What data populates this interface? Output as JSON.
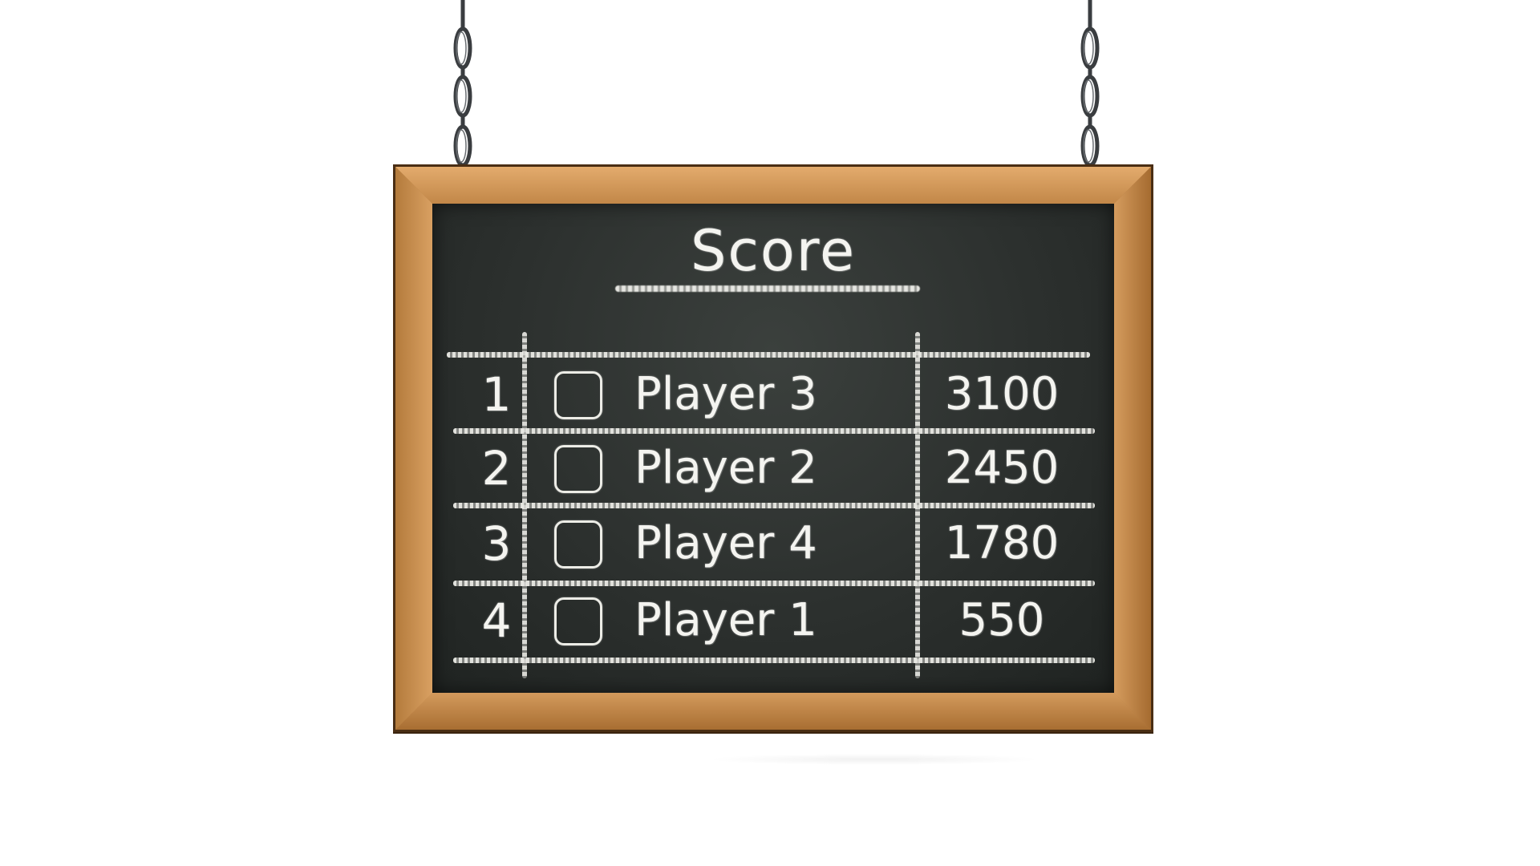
{
  "scoreboard": {
    "title": "Score",
    "rows": [
      {
        "rank": "1",
        "player": "Player 3",
        "score": "3100"
      },
      {
        "rank": "2",
        "player": "Player 2",
        "score": "2450"
      },
      {
        "rank": "3",
        "player": "Player 4",
        "score": "1780"
      },
      {
        "rank": "4",
        "player": "Player 1",
        "score": "550"
      }
    ]
  },
  "colors": {
    "chalkboard": "#2c302e",
    "frame_wood": "#c68b4c",
    "chalk": "#f4f4f0",
    "chain": "#3a3d40"
  }
}
